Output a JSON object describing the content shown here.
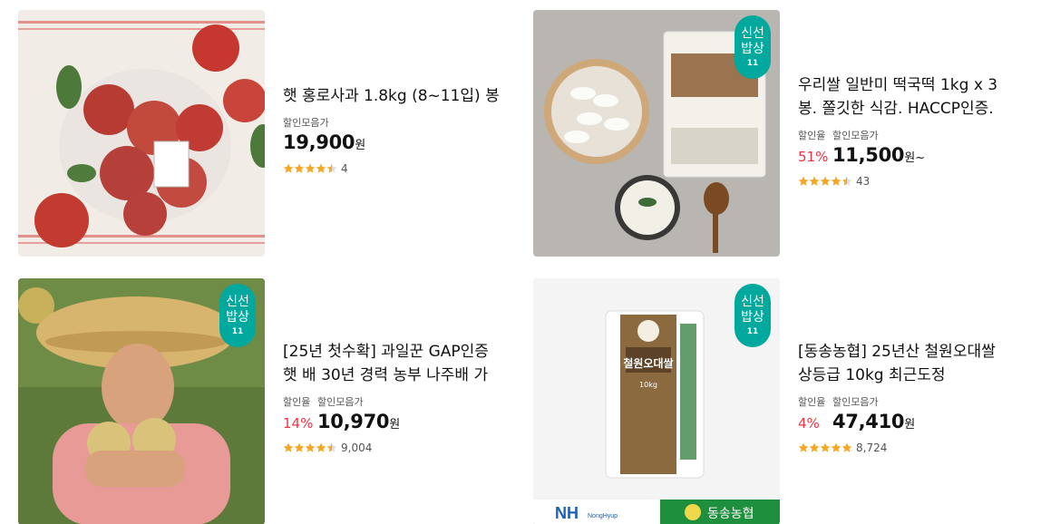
{
  "colors": {
    "accent": "#00a89d",
    "discount": "#f43142",
    "star": "#f5a623"
  },
  "products": [
    {
      "title_lines": [
        "햇 홍로사과 1.8kg (8~11입) 봉"
      ],
      "badge": null,
      "label_rate": "",
      "label_price": "할인모음가",
      "rate": "",
      "price": "19,900",
      "unit": "원",
      "rating": 4.5,
      "review_count": "4",
      "image_icon": "apple-bag-photo"
    },
    {
      "title_lines": [
        "우리쌀 일반미 떡국떡 1kg x 3",
        "봉. 쫄깃한 식감. HACCP인증."
      ],
      "badge": {
        "line1": "신선",
        "line2": "밥상",
        "line3": "11"
      },
      "label_rate": "할인율",
      "label_price": "할인모음가",
      "rate": "51%",
      "price": "11,500",
      "unit": "원~",
      "rating": 4.5,
      "review_count": "43",
      "image_icon": "rice-cake-photo"
    },
    {
      "title_lines": [
        "[25년 첫수확] 과일꾼 GAP인증",
        "햇 배 30년 경력 농부 나주배 가"
      ],
      "badge": {
        "line1": "신선",
        "line2": "밥상",
        "line3": "11"
      },
      "label_rate": "할인율",
      "label_price": "할인모음가",
      "rate": "14%",
      "price": "10,970",
      "unit": "원",
      "rating": 4.5,
      "review_count": "9,004",
      "image_icon": "pear-farmer-photo"
    },
    {
      "title_lines": [
        "[동송농협] 25년산 철원오대쌀",
        "상등급 10kg 최근도정"
      ],
      "badge": {
        "line1": "신선",
        "line2": "밥상",
        "line3": "11"
      },
      "label_rate": "할인율",
      "label_price": "할인모음가",
      "rate": "4%",
      "price": "47,410",
      "unit": "원",
      "rating": 5,
      "review_count": "8,724",
      "image_icon": "rice-bag-photo",
      "image_texts": {
        "nh": "NH",
        "nh_sub": "NongHyup",
        "coop": "동송농협",
        "brand": "철원오대쌀",
        "weight": "10kg"
      }
    }
  ]
}
